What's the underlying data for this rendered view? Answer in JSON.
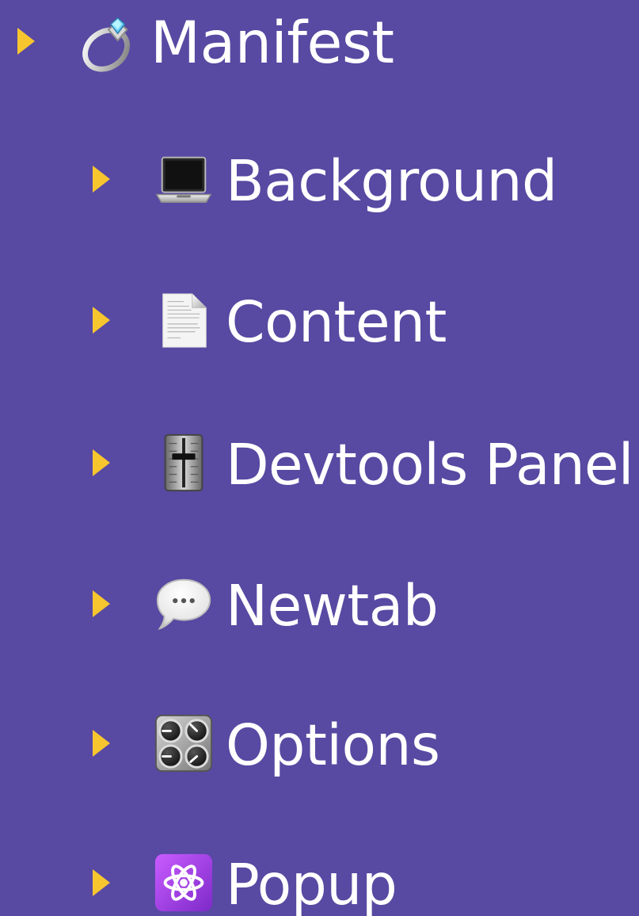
{
  "tree": {
    "items": [
      {
        "label": "Manifest",
        "icon": "ring-icon",
        "level": 0
      },
      {
        "label": "Background",
        "icon": "laptop-icon",
        "level": 1
      },
      {
        "label": "Content",
        "icon": "page-icon",
        "level": 1
      },
      {
        "label": "Devtools Panel",
        "icon": "level-slider-icon",
        "level": 1
      },
      {
        "label": "Newtab",
        "icon": "speech-balloon-icon",
        "level": 1
      },
      {
        "label": "Options",
        "icon": "control-knobs-icon",
        "level": 1
      },
      {
        "label": "Popup",
        "icon": "atom-symbol-icon",
        "level": 1
      }
    ]
  },
  "colors": {
    "background": "#5849a2",
    "caret": "#f7c62f",
    "text": "#ffffff"
  }
}
